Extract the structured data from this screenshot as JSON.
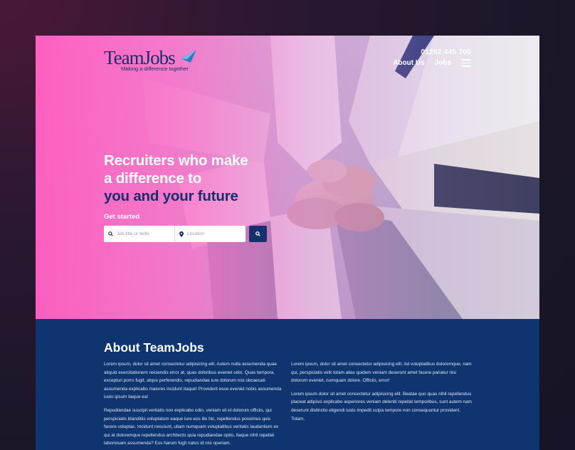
{
  "header": {
    "logo_text": "TeamJobs",
    "logo_tagline": "Making a difference together",
    "phone": "01202 445 700",
    "nav": [
      {
        "label": "About Us"
      },
      {
        "label": "Jobs"
      }
    ]
  },
  "hero": {
    "headline_line1": "Recruiters who make",
    "headline_line2": "a difference to",
    "headline_line3": "you and your future",
    "get_started": "Get started",
    "search": {
      "job_placeholder": "Job title or skills",
      "location_placeholder": "Location"
    }
  },
  "about": {
    "title": "About TeamJobs",
    "left_paragraphs": [
      "Lorem ipsum, dolor sit amet consectetur adipisicing elit. Autem nulla assumenda quae aliquid exercitationem reiciendis error at, quas doloribus eveniet odio. Quas tempora, excepturi porro fugit, atque perferendis, repudiandae iure dolorum nisi obcaecati assumenda explicabo maiores incidunt itaque! Provident esse eveniet nobis assumenda iusto ipsum itaque ea!",
      "Repudiandae suscipit veritatis non explicabo odio, veniam sit et dolorum officiis, qui perspiciatis blanditiis voluptatum eaque iure eos illo hic, repellendus possimus quis facere voluptas. Incidunt nesciunt, ullam numquam voluptatibus veritatis laudantium ex qui at doloremque repellendus architecto quia repudiandae optio, itaque nihil repellat laboriosam assumenda? Eos harum fugit natus id nisi operiam."
    ],
    "right_paragraphs": [
      "Lorem ipsum, dolor sit amet consectetur adipisicing elit. Ad voluptatibus doloremque, nam qui, perspiciatis velit totam alias quidem veniam deserunt amet facere pariatur nisi dolorum eveniet, numquam dolore. Officiis, error!",
      "Lorem ipsum dolor sit amet consectetur adipisicing elit. Beatae quo quas nihil repellendus placeat adipisci explicabo asperiores veniam deleniti repellat temporibus, sunt autem nam deserunt distinctio eligendi iusto impedit culpa tempore non consequuntur provident. Totam."
    ]
  },
  "colors": {
    "navy": "#0e3570",
    "button": "#15306d",
    "pink": "#ff5abe"
  }
}
